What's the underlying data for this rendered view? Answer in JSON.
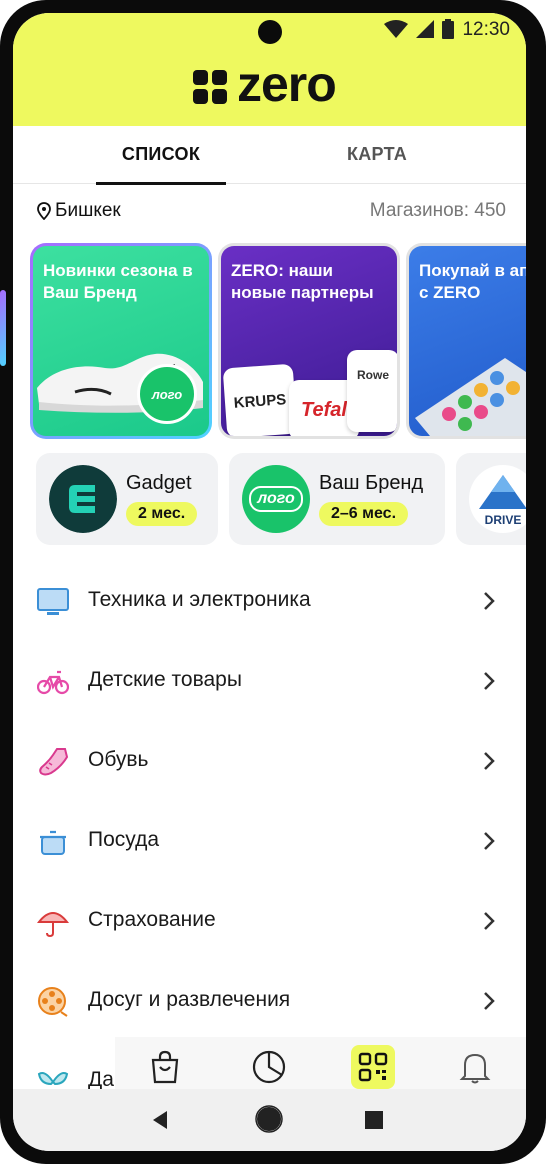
{
  "app": {
    "brand": "zero"
  },
  "status_bar": {
    "time": "12:30"
  },
  "tabs": [
    {
      "label": "СПИСОК",
      "active": true
    },
    {
      "label": "КАРТА",
      "active": false
    }
  ],
  "location": {
    "city": "Бишкек",
    "shops_count": "Магазинов: 450"
  },
  "banners": [
    {
      "title": "Новинки сезона в Ваш Бренд",
      "badge": "лого"
    },
    {
      "title": "ZERO: наши новые партнеры",
      "partners": [
        "KRUPS",
        "Tefal",
        "Rowe"
      ]
    },
    {
      "title": "Покупай в аптеках с ZERO"
    }
  ],
  "stores": [
    {
      "name": "Gadget",
      "term": "2 мес."
    },
    {
      "name": "Ваш Бренд",
      "term": "2–6 мес.",
      "logo_text": "лого"
    },
    {
      "name": "DRIVE"
    }
  ],
  "categories": [
    {
      "label": "Техника и электроника",
      "icon": "monitor-icon"
    },
    {
      "label": "Детские товары",
      "icon": "bicycle-icon"
    },
    {
      "label": "Обувь",
      "icon": "shoe-icon"
    },
    {
      "label": "Посуда",
      "icon": "pot-icon"
    },
    {
      "label": "Страхование",
      "icon": "umbrella-icon"
    },
    {
      "label": "Досуг и развлечения",
      "icon": "film-reel-icon"
    },
    {
      "label": "Да",
      "icon": "butterfly-icon"
    }
  ],
  "bottom_nav": [
    {
      "icon": "shopping-bag-icon"
    },
    {
      "icon": "pie-chart-icon"
    },
    {
      "icon": "qr-code-icon",
      "active": true
    },
    {
      "icon": "bell-icon"
    }
  ],
  "colors": {
    "accent": "#eef95f",
    "green": "#19c36a",
    "chip_bg": "#f1f2f4"
  }
}
